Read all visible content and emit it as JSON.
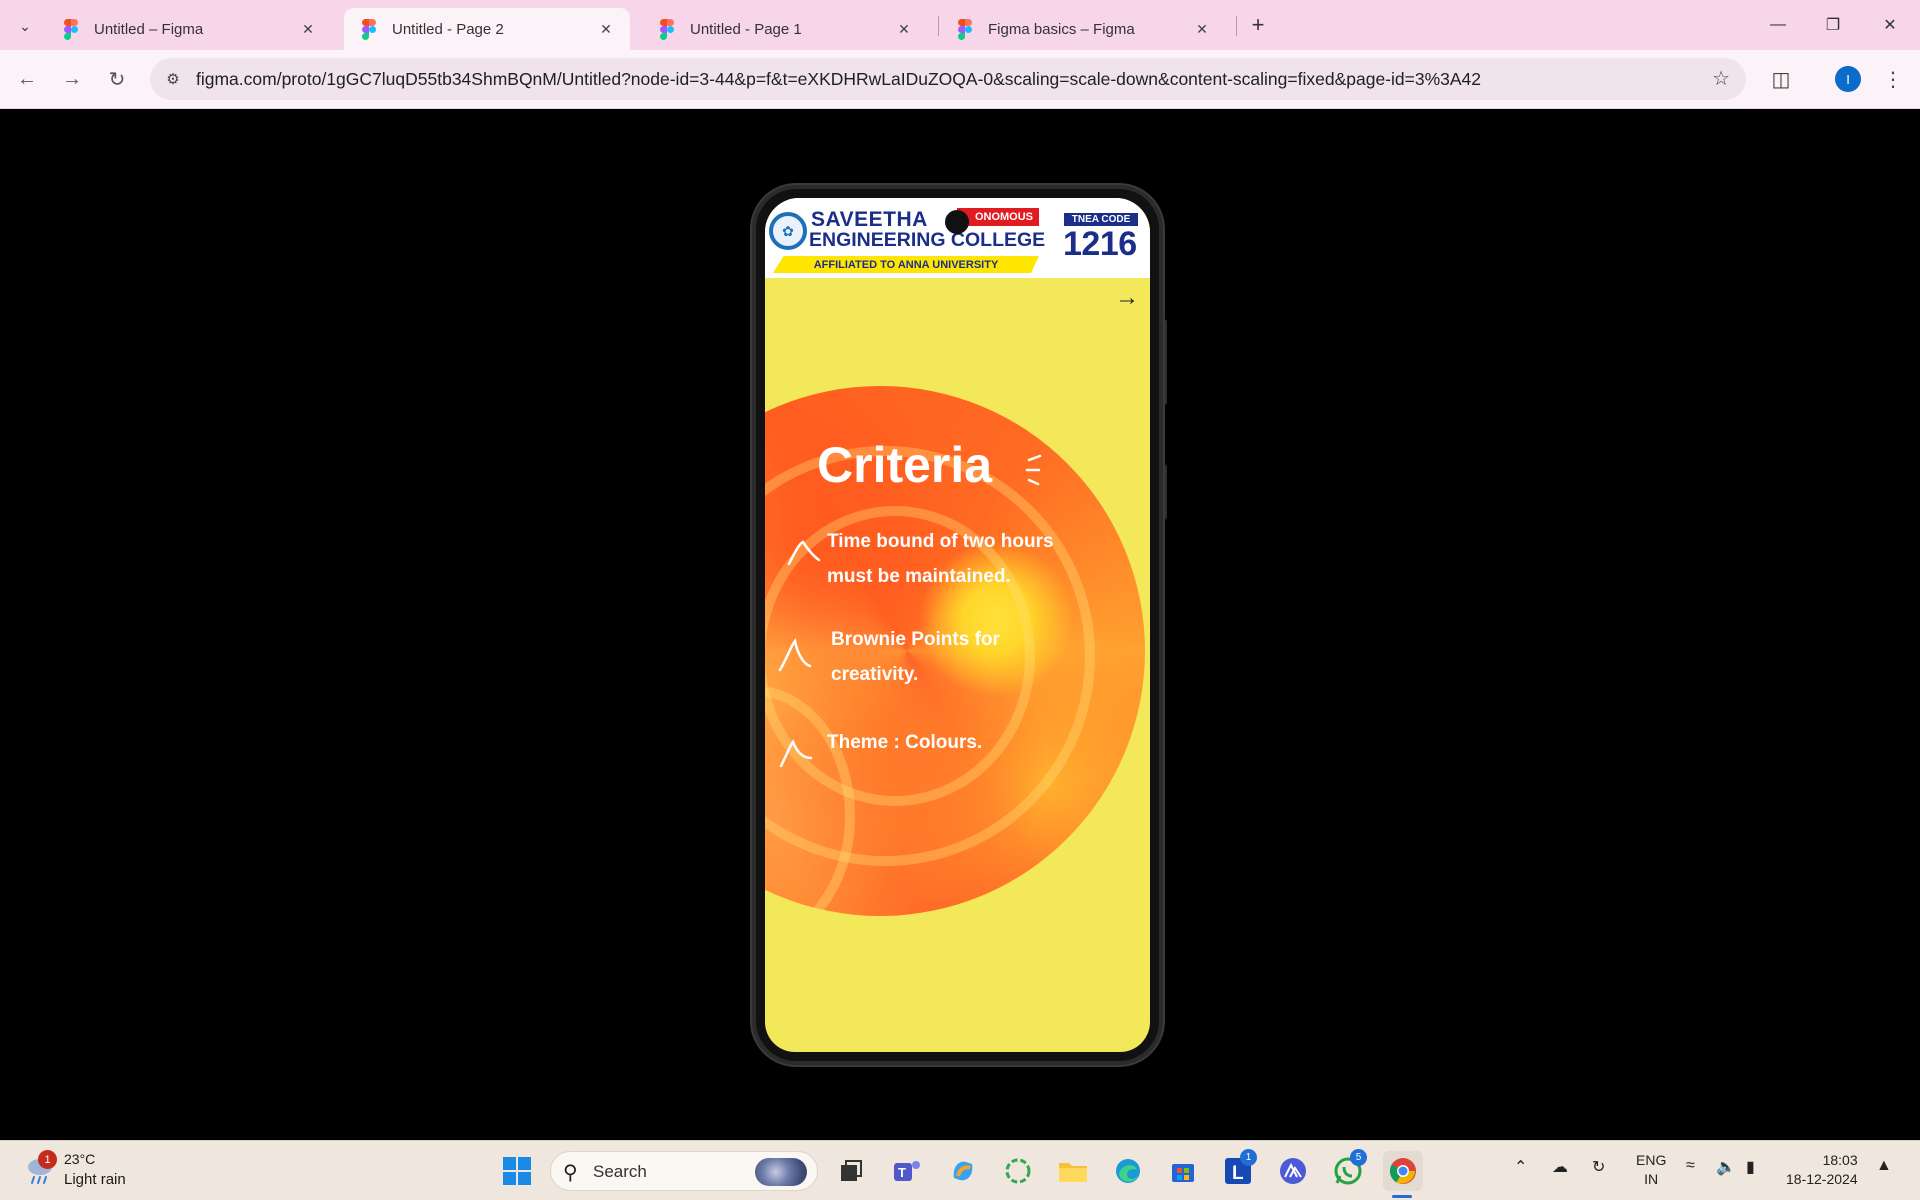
{
  "browser": {
    "tabs": [
      {
        "title": "Untitled – Figma",
        "active": false
      },
      {
        "title": "Untitled - Page 2",
        "active": true
      },
      {
        "title": "Untitled - Page 1",
        "active": false
      },
      {
        "title": "Figma basics – Figma",
        "active": false
      }
    ],
    "url": "figma.com/proto/1gGC7luqD55tb34ShmBQnM/Untitled?node-id=3-44&p=f&t=eXKDHRwLaIDuZOQA-0&scaling=scale-down&content-scaling=fixed&page-id=3%3A42",
    "profile_initial": "I"
  },
  "prototype": {
    "header": {
      "college_line1": "SAVEETHA",
      "college_line2": "ENGINEERING COLLEGE",
      "autonomous_badge": "ONOMOUS",
      "affiliation": "AFFILIATED TO ANNA UNIVERSITY",
      "tnea_label": "TNEA CODE",
      "tnea_code": "1216"
    },
    "title": "Criteria",
    "items": [
      {
        "line1": "Time bound of two hours",
        "line2": "must be maintained."
      },
      {
        "line1": "Brownie Points for",
        "line2": "creativity."
      },
      {
        "line1": "Theme : Colours.",
        "line2": ""
      }
    ],
    "colors": {
      "background": "#f3e85a",
      "blob_primary": "#ff6a22",
      "blob_highlight": "#ffe23a",
      "text": "#ffffff"
    }
  },
  "taskbar": {
    "weather_temp": "23°C",
    "weather_desc": "Light rain",
    "weather_badge": "1",
    "search_placeholder": "Search",
    "linkedin_badge": "1",
    "whatsapp_badge": "5",
    "language_line1": "ENG",
    "language_line2": "IN",
    "time": "18:03",
    "date": "18-12-2024"
  }
}
